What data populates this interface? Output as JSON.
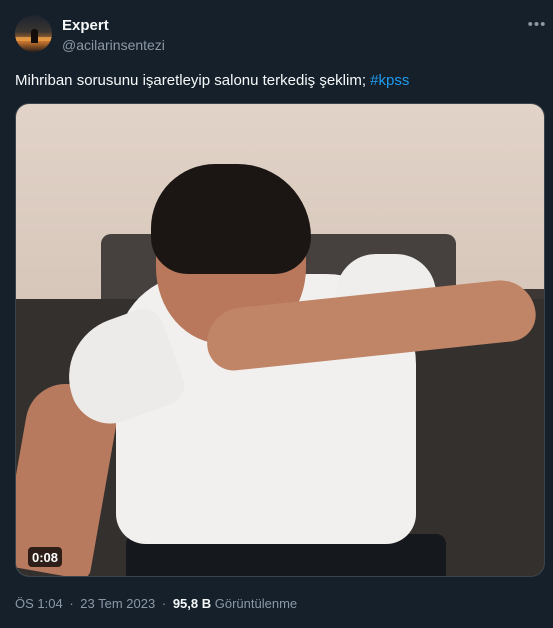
{
  "author": {
    "name": "Expert",
    "handle": "@acilarinsentezi"
  },
  "tweet": {
    "text": "Mihriban sorusunu işaretleyip salonu terkediş şeklim;",
    "hashtag": "#kpss"
  },
  "media": {
    "type": "video",
    "duration": "0:08"
  },
  "meta": {
    "time": "ÖS 1:04",
    "separator": "·",
    "date": "23 Tem 2023",
    "views_count": "95,8 B",
    "views_label": "Görüntülenme"
  },
  "icons": {
    "more": "more-horizontal-icon"
  },
  "colors": {
    "background": "#15202b",
    "text": "#f7f9f9",
    "secondary": "#8b98a5",
    "link": "#1d9bf0",
    "border": "#38444d"
  }
}
